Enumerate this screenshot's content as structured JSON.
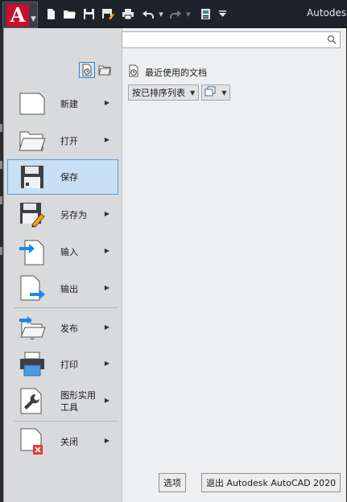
{
  "title_bar": {
    "app_title": "Autodesk",
    "quick_access_icons": [
      "new-icon",
      "open-icon",
      "save-icon",
      "save-as-icon",
      "plot-icon",
      "undo-icon",
      "undo-dropdown-icon",
      "redo-icon",
      "redo-dropdown-icon",
      "workspace-icon",
      "customize-dropdown-icon"
    ]
  },
  "search": {
    "placeholder": "",
    "value": ""
  },
  "left_menu": {
    "items": [
      {
        "key": "new",
        "label": "新建",
        "has_arrow": true
      },
      {
        "key": "open",
        "label": "打开",
        "has_arrow": true
      },
      {
        "key": "save",
        "label": "保存",
        "has_arrow": false,
        "selected": true
      },
      {
        "key": "save_as",
        "label": "另存为",
        "has_arrow": true
      },
      {
        "key": "import",
        "label": "输入",
        "has_arrow": true
      },
      {
        "key": "export",
        "label": "输出",
        "has_arrow": true
      },
      {
        "key": "publish",
        "label": "发布",
        "has_arrow": true
      },
      {
        "key": "print",
        "label": "打印",
        "has_arrow": true
      },
      {
        "key": "utilities",
        "label": "图形实用\n工具",
        "has_arrow": true
      },
      {
        "key": "close",
        "label": "关闭",
        "has_arrow": true
      }
    ]
  },
  "right_panel": {
    "recent_header": "最近使用的文档",
    "sort_dropdown": "按已排序列表"
  },
  "bottom_buttons": {
    "options": "选项",
    "exit": "退出 Autodesk AutoCAD 2020"
  },
  "colors": {
    "accent_selected": "#c9dff3",
    "selected_border": "#5b9bd5",
    "logo_red": "#c8102e",
    "arrow_blue": "#1e88e5"
  }
}
